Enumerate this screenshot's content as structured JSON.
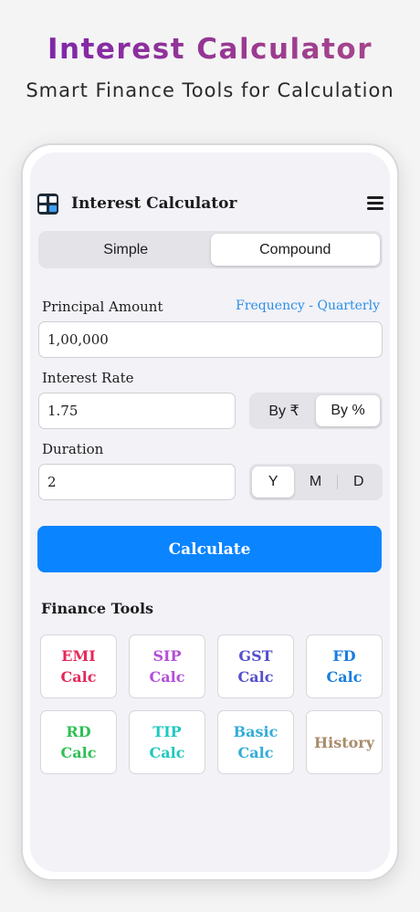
{
  "promo": {
    "title": "Interest Calculator",
    "subtitle": "Smart Finance Tools for Calculation"
  },
  "appbar": {
    "title": "Interest Calculator",
    "icon": "calculator-app-icon",
    "menu_icon": "hamburger-menu-icon"
  },
  "mode_tabs": [
    {
      "label": "Simple",
      "active": false
    },
    {
      "label": "Compound",
      "active": true
    }
  ],
  "principal": {
    "label": "Principal Amount",
    "value": "1,00,000",
    "frequency_link": "Frequency - Quarterly"
  },
  "rate": {
    "label": "Interest Rate",
    "value": "1.75",
    "options": [
      {
        "label": "By ₹",
        "active": false
      },
      {
        "label": "By %",
        "active": true
      }
    ]
  },
  "duration": {
    "label": "Duration",
    "value": "2",
    "options": [
      {
        "label": "Y",
        "active": true
      },
      {
        "label": "M",
        "active": false
      },
      {
        "label": "D",
        "active": false
      }
    ]
  },
  "calculate_label": "Calculate",
  "finance_tools": {
    "title": "Finance Tools",
    "items": [
      {
        "label": "EMI\nCalc",
        "color": "#e5275a"
      },
      {
        "label": "SIP\nCalc",
        "color": "#b44fd6"
      },
      {
        "label": "GST\nCalc",
        "color": "#5550cc"
      },
      {
        "label": "FD\nCalc",
        "color": "#1a7ee0"
      },
      {
        "label": "RD\nCalc",
        "color": "#2fbf55"
      },
      {
        "label": "TIP\nCalc",
        "color": "#1ec9c0"
      },
      {
        "label": "Basic\nCalc",
        "color": "#34acd8"
      },
      {
        "label": "History",
        "color": "#a98b6b"
      }
    ]
  },
  "colors": {
    "accent": "#0a84ff",
    "link": "#2b8fe8"
  }
}
